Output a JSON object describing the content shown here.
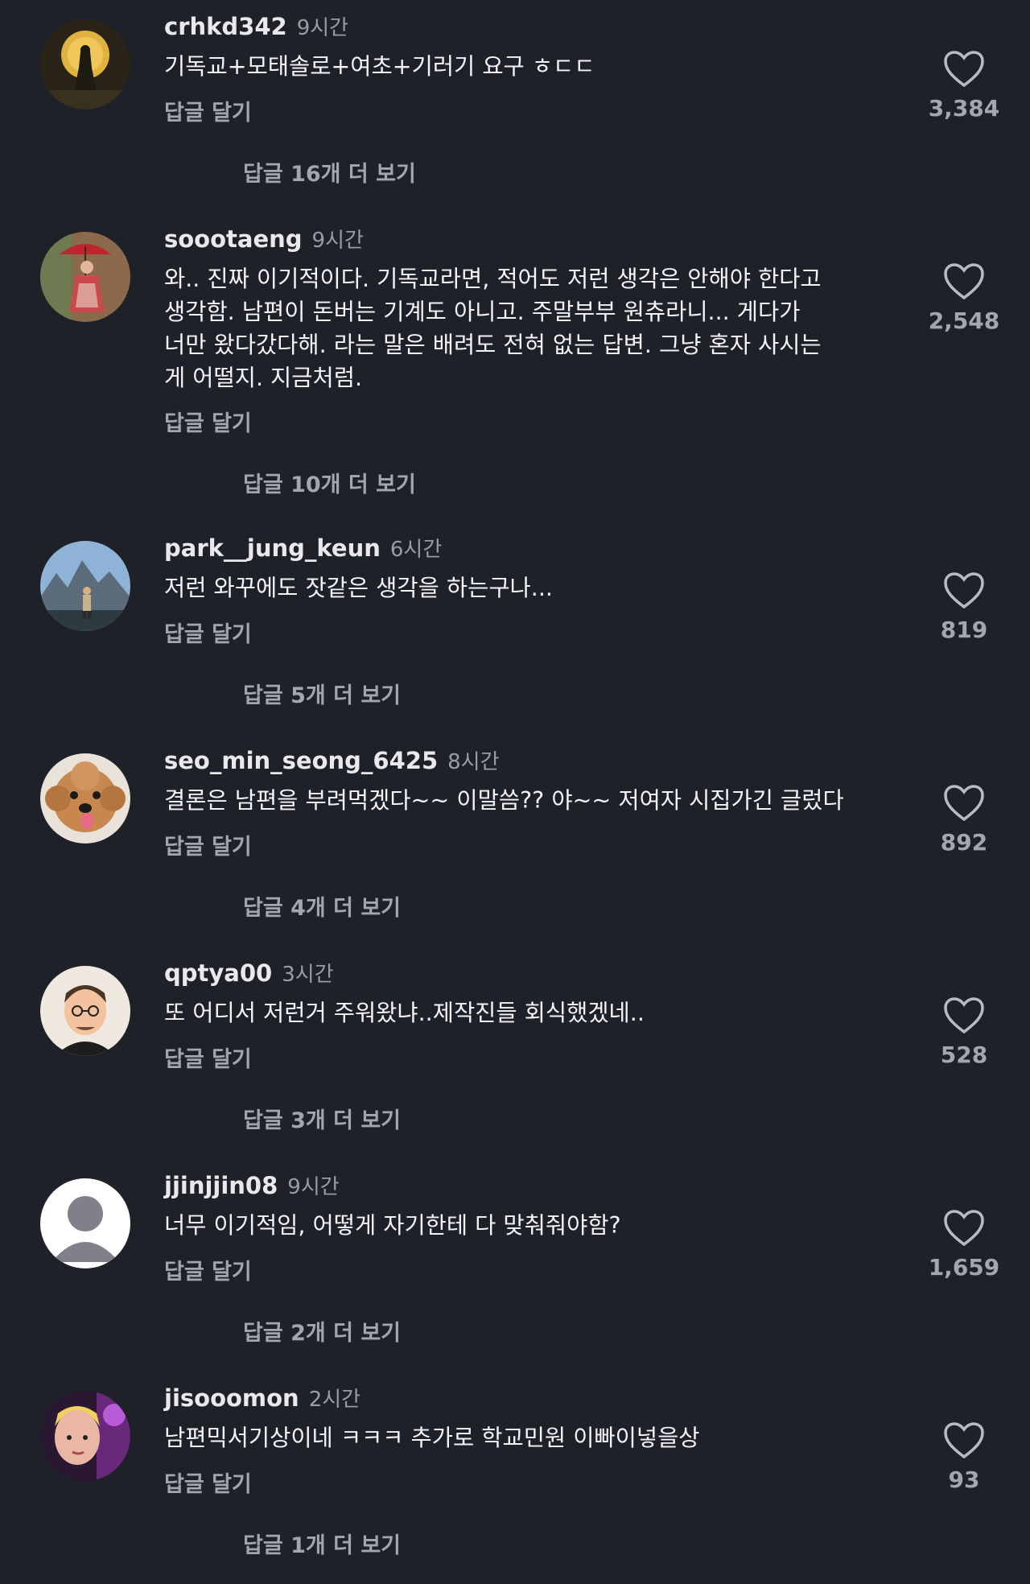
{
  "comments": [
    {
      "username": "crhkd342",
      "time": "9시간",
      "text": "기독교+모태솔로+여초+기러기 요구 ㅎㄷㄷ",
      "reply_label": "답글 달기",
      "view_replies": "답글 16개 더 보기",
      "likes": "3,384",
      "avatar_icon": "moon-silhouette-avatar"
    },
    {
      "username": "soootaeng",
      "time": "9시간",
      "text": "와.. 진짜 이기적이다. 기독교라면, 적어도 저런 생각은 안해야 한다고\n생각함. 남편이 돈버는 기계도 아니고. 주말부부 원츄라니... 게다가\n너만 왔다갔다해. 라는 말은 배려도 전혀 없는 답변. 그냥 혼자 사시는\n게 어떨지. 지금처럼.",
      "reply_label": "답글 달기",
      "view_replies": "답글 10개 더 보기",
      "likes": "2,548",
      "avatar_icon": "woman-umbrella-avatar"
    },
    {
      "username": "park__jung_keun",
      "time": "6시간",
      "text": "저런 와꾸에도 잣같은 생각을 하는구나...",
      "reply_label": "답글 달기",
      "view_replies": "답글 5개 더 보기",
      "likes": "819",
      "avatar_icon": "mountain-person-avatar"
    },
    {
      "username": "seo_min_seong_6425",
      "time": "8시간",
      "text": "결론은 남편을 부려먹겠다~~ 이말씀?? 야~~ 저여자 시집가긴 글렀다",
      "reply_label": "답글 달기",
      "view_replies": "답글 4개 더 보기",
      "likes": "892",
      "avatar_icon": "poodle-dog-avatar"
    },
    {
      "username": "qptya00",
      "time": "3시간",
      "text": "또 어디서 저런거 주워왔냐..제작진들 회식했겠네..",
      "reply_label": "답글 달기",
      "view_replies": "답글 3개 더 보기",
      "likes": "528",
      "avatar_icon": "cartoon-man-avatar"
    },
    {
      "username": "jjinjjin08",
      "time": "9시간",
      "text": "너무 이기적임, 어떻게 자기한테 다 맞춰줘야함?",
      "reply_label": "답글 달기",
      "view_replies": "답글 2개 더 보기",
      "likes": "1,659",
      "avatar_icon": "default-user-avatar"
    },
    {
      "username": "jisooomon",
      "time": "2시간",
      "text": "남편믹서기상이네 ㅋㅋㅋ 추가로 학교민원 이빠이넣을상",
      "reply_label": "답글 달기",
      "view_replies": "답글 1개 더 보기",
      "likes": "93",
      "avatar_icon": "purple-light-person-avatar"
    }
  ],
  "colors": {
    "background": "#1f2129",
    "primary_text": "#f4f4f6",
    "secondary_text": "#a4a6ae",
    "time_text": "#9a9ca5"
  }
}
